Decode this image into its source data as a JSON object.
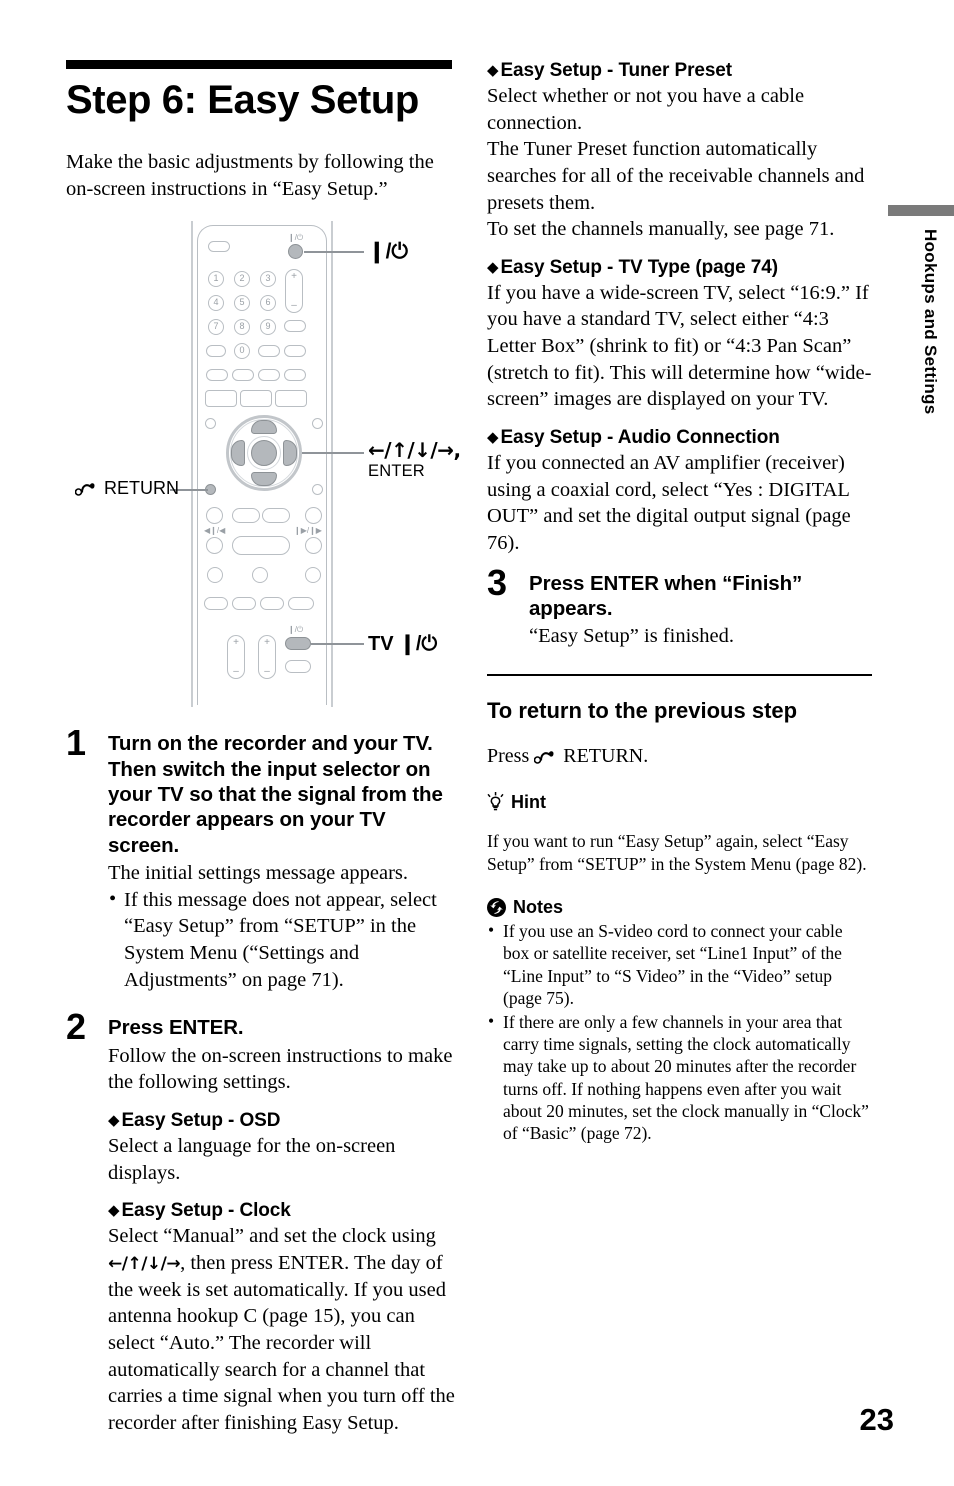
{
  "document": {
    "title": "Step 6: Easy Setup",
    "intro": "Make the basic adjustments by following the on-screen instructions in “Easy Setup.”",
    "page_number": "23",
    "side_tab_label": "Hookups and Settings",
    "side_tab_color": "#7a7a7a"
  },
  "figure": {
    "callout_power": "❙/⏻",
    "callout_dpad": "←/↑/↓/→,",
    "callout_enter": "ENTER",
    "callout_return": "RETURN",
    "callout_tv_power": "TV ❙/⏻",
    "keypad_digits": [
      "1",
      "2",
      "3",
      "4",
      "5",
      "6",
      "7",
      "8",
      "9",
      "0"
    ],
    "rocker_plus": "+",
    "rocker_minus": "–",
    "tiny_label_power": "❙/⏻",
    "tiny_label_prev": "◀❙/◀",
    "tiny_label_next": "❙▶/❙▶",
    "tiny_label_tv_power": "❙/⏻"
  },
  "steps": [
    {
      "number": "1",
      "heading": "Turn on the recorder and your TV. Then switch the input selector on your TV so that the signal from the recorder appears on your TV screen.",
      "body": "The initial settings message appears.",
      "bullets": [
        "If this message does not appear, select “Easy Setup” from “SETUP” in the System Menu (“Settings and Adjustments” on page 71)."
      ]
    },
    {
      "number": "2",
      "heading": "Press ENTER.",
      "body": "Follow the on-screen instructions to make the following settings."
    },
    {
      "number": "3",
      "heading": "Press ENTER when “Finish” appears.",
      "body": "“Easy Setup” is finished."
    }
  ],
  "sections_left": [
    {
      "title": "Easy Setup - OSD",
      "body": "Select a language for the on-screen displays."
    },
    {
      "title": "Easy Setup - Clock",
      "body_part1": "Select “Manual” and set the clock using ",
      "arrows": "←/↑/↓/→",
      "body_part2": ", then press ENTER. The day of the week is set automatically. If you used antenna hookup C (page 15), you can select “Auto.” The recorder will automatically search for a channel that carries a time signal when you turn off the recorder after finishing Easy Setup."
    }
  ],
  "sections_right": [
    {
      "title": "Easy Setup - Tuner Preset",
      "body": "Select whether or not you have a cable connection.\nThe Tuner Preset function automatically searches for all of the receivable channels and presets them.\nTo set the channels manually, see page 71."
    },
    {
      "title": "Easy Setup - TV Type (page 74)",
      "body": "If you have a wide-screen TV, select “16:9.” If you have a standard TV, select either “4:3 Letter Box” (shrink to fit) or “4:3 Pan Scan” (stretch to fit). This will determine how “wide-screen” images are displayed on your TV."
    },
    {
      "title": "Easy Setup - Audio Connection",
      "body": "If you connected an AV amplifier (receiver) using a coaxial cord, select “Yes : DIGITAL OUT” and set the digital output signal (page 76)."
    }
  ],
  "return_block": {
    "heading": "To return to the previous step",
    "press_word": "Press",
    "return_label": "RETURN."
  },
  "hint": {
    "heading": "Hint",
    "body": "If you want to run “Easy Setup” again, select “Easy Setup” from “SETUP” in the System Menu (page 82)."
  },
  "notes": {
    "heading": "Notes",
    "items": [
      "If you use an S-video cord to connect your cable box or satellite receiver, set “Line1 Input” of the “Line Input” to “S Video” in the “Video” setup (page 75).",
      "If there are only a few channels in your area that carry time signals, setting the clock automatically may take up to about 20 minutes after the recorder turns off. If nothing happens even after you wait about 20 minutes, set the clock manually in “Clock” of “Basic” (page 72)."
    ]
  }
}
